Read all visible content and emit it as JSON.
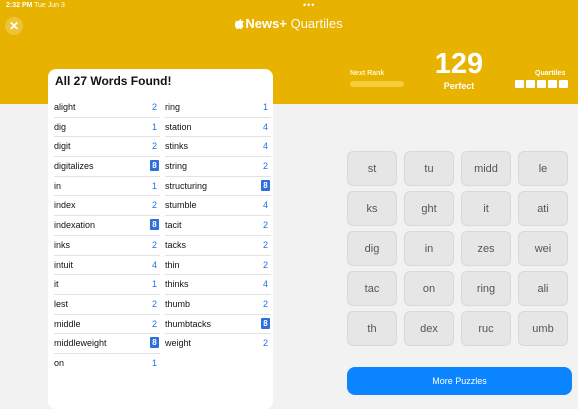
{
  "status_bar": {
    "time": "2:32 PM",
    "date": "Tue Jun 3",
    "dots": "•••"
  },
  "header": {
    "close_label": "✕",
    "brand": "News+",
    "subtitle": "Quartiles",
    "band_color": "#e8b200"
  },
  "progress": {
    "next_rank_label": "Next Rank",
    "score": "129",
    "rank": "Perfect",
    "quartiles_label": "Quartiles",
    "quartiles_found": 5,
    "quartiles_total": 5
  },
  "words_panel": {
    "title": "All 27 Words Found!",
    "left_column": [
      {
        "word": "alight",
        "score": "2"
      },
      {
        "word": "dig",
        "score": "1"
      },
      {
        "word": "digit",
        "score": "2"
      },
      {
        "word": "digitalizes",
        "score": "8"
      },
      {
        "word": "in",
        "score": "1"
      },
      {
        "word": "index",
        "score": "2"
      },
      {
        "word": "indexation",
        "score": "8"
      },
      {
        "word": "inks",
        "score": "2"
      },
      {
        "word": "intuit",
        "score": "4"
      },
      {
        "word": "it",
        "score": "1"
      },
      {
        "word": "lest",
        "score": "2"
      },
      {
        "word": "middle",
        "score": "2"
      },
      {
        "word": "middleweight",
        "score": "8"
      },
      {
        "word": "on",
        "score": "1"
      }
    ],
    "right_column": [
      {
        "word": "ring",
        "score": "1"
      },
      {
        "word": "station",
        "score": "4"
      },
      {
        "word": "stinks",
        "score": "4"
      },
      {
        "word": "string",
        "score": "2"
      },
      {
        "word": "structuring",
        "score": "8"
      },
      {
        "word": "stumble",
        "score": "4"
      },
      {
        "word": "tacit",
        "score": "2"
      },
      {
        "word": "tacks",
        "score": "2"
      },
      {
        "word": "thin",
        "score": "2"
      },
      {
        "word": "thinks",
        "score": "4"
      },
      {
        "word": "thumb",
        "score": "2"
      },
      {
        "word": "thumbtacks",
        "score": "8"
      },
      {
        "word": "weight",
        "score": "2"
      }
    ]
  },
  "tiles": [
    "st",
    "tu",
    "midd",
    "le",
    "ks",
    "ght",
    "it",
    "ati",
    "dig",
    "in",
    "zes",
    "wei",
    "tac",
    "on",
    "ring",
    "ali",
    "th",
    "dex",
    "ruc",
    "umb"
  ],
  "more_button": {
    "label": "More Puzzles",
    "color": "#0b84ff"
  }
}
